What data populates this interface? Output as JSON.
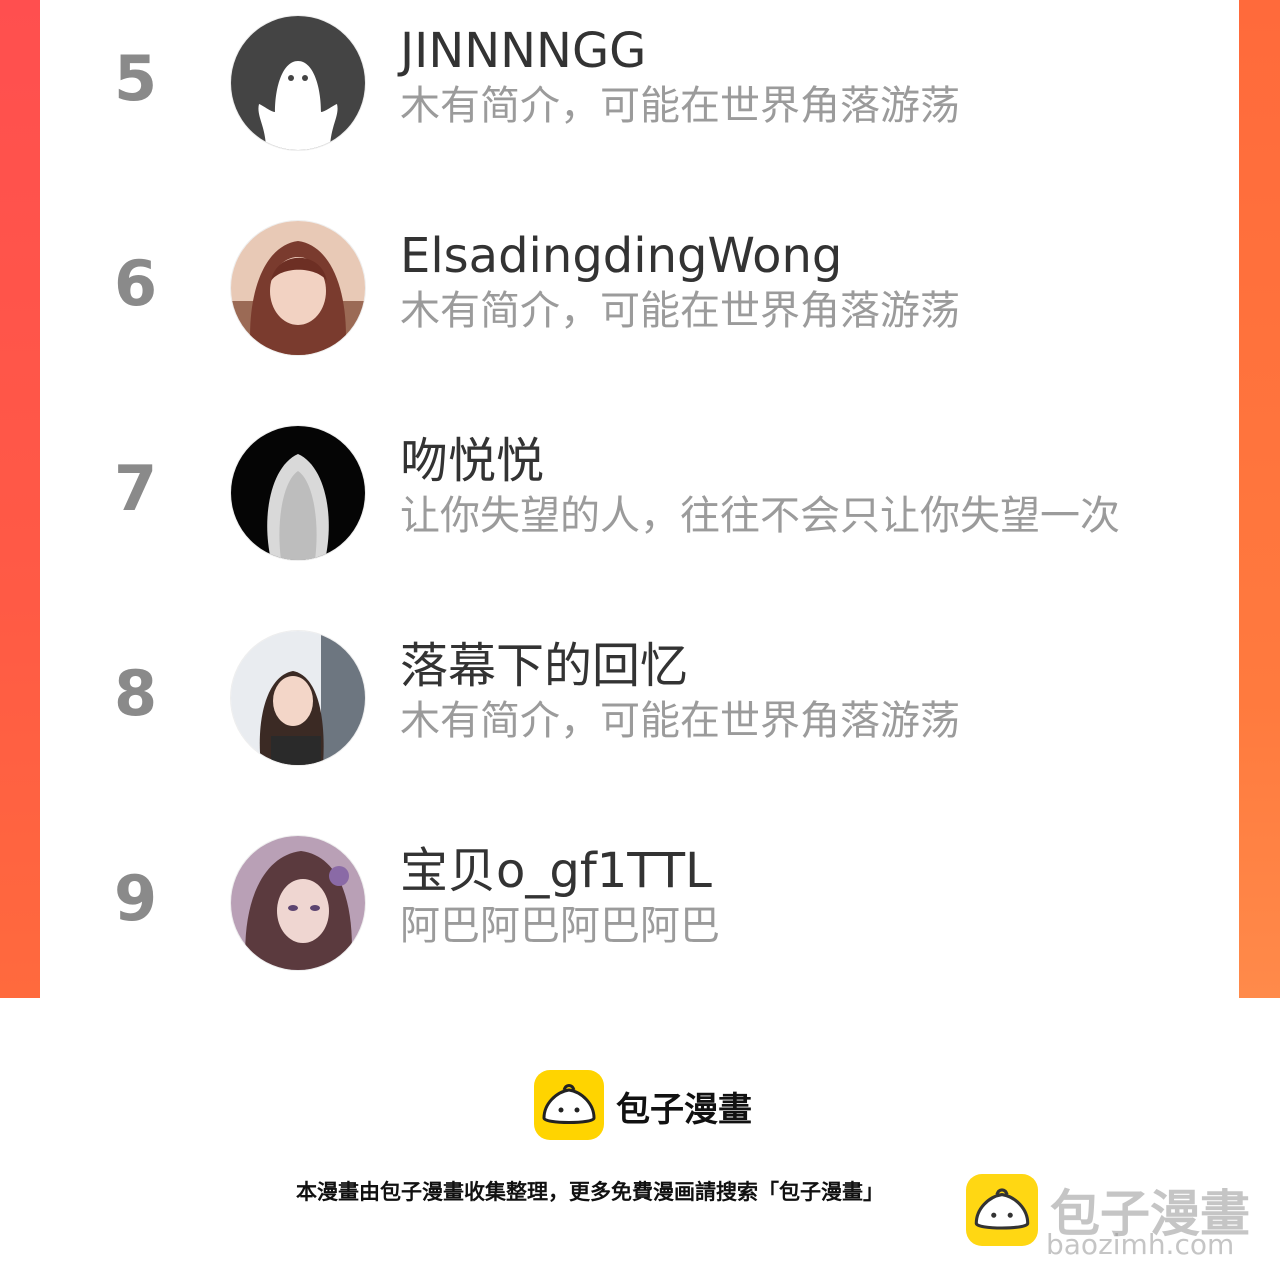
{
  "ranking": [
    {
      "rank": "5",
      "name": "JINNNNGG",
      "bio": "木有简介，可能在世界角落游荡",
      "avatar": "default-ghost-avatar"
    },
    {
      "rank": "6",
      "name": "ElsadingdingWong",
      "bio": "木有简介，可能在世界角落游荡",
      "avatar": "user-photo-avatar"
    },
    {
      "rank": "7",
      "name": "吻悦悦",
      "bio": "让你失望的人，往往不会只让你失望一次",
      "avatar": "user-photo-avatar"
    },
    {
      "rank": "8",
      "name": "落幕下的回忆",
      "bio": "木有简介，可能在世界角落游荡",
      "avatar": "user-photo-avatar"
    },
    {
      "rank": "9",
      "name": "宝贝o_gf1TTL",
      "bio": "阿巴阿巴阿巴阿巴",
      "avatar": "user-illustration-avatar"
    }
  ],
  "footer": {
    "brand_name": "包子漫畫",
    "notice": "本漫畫由包子漫畫收集整理，更多免費漫画請搜索「包子漫畫」",
    "watermark_text": "包子漫畫",
    "watermark_url": "baozimh.com"
  },
  "colors": {
    "frame_left": "#ff5148",
    "frame_right": "#ff7a3e",
    "rank_text": "#8a8a8a",
    "name_text": "#333333",
    "bio_text": "#9b9b9b",
    "logo_yellow": "#ffd400"
  }
}
